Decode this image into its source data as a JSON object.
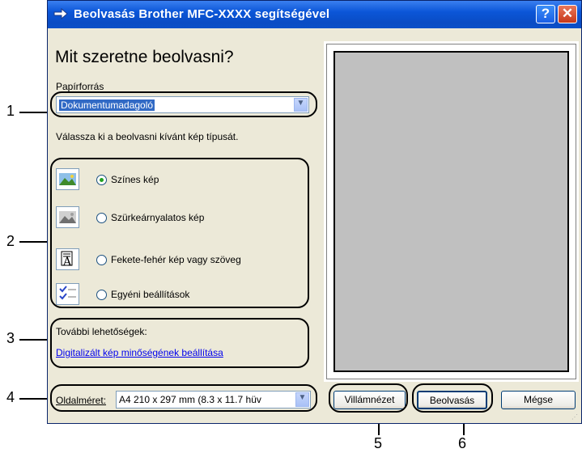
{
  "window": {
    "title": "Beolvasás Brother MFC-XXXX  segítségével",
    "help_label": "?",
    "close_label": "✕"
  },
  "main": {
    "heading": "Mit szeretne beolvasni?",
    "paper_source": {
      "label": "Papírforrás",
      "value": "Dokumentumadagoló"
    },
    "image_type_prompt": "Válassza ki a beolvasni kívánt kép típusát.",
    "image_types": [
      {
        "label": "Színes kép",
        "icon": "color-photo-icon",
        "checked": true
      },
      {
        "label": "Szürkeárnyalatos kép",
        "icon": "grayscale-photo-icon",
        "checked": false
      },
      {
        "label": "Fekete-fehér kép vagy szöveg",
        "icon": "bw-document-icon",
        "checked": false
      },
      {
        "label": "Egyéni beállítások",
        "icon": "custom-settings-icon",
        "checked": false
      }
    ],
    "more_options": {
      "label": "További lehetőségek:",
      "link": "Digitalizált kép minőségének beállítása"
    },
    "page_size": {
      "label": "Oldalméret:",
      "value": "A4 210 x 297 mm (8.3 x 11.7 hüv"
    }
  },
  "buttons": {
    "preview": "Villámnézet",
    "scan": "Beolvasás",
    "cancel": "Mégse"
  },
  "callouts": [
    "1",
    "2",
    "3",
    "4",
    "5",
    "6"
  ],
  "colors": {
    "titlebar": "#0b56d8",
    "dialog_bg": "#ece9d8",
    "link": "#0000ee",
    "preview_page": "#c0c0c0"
  }
}
